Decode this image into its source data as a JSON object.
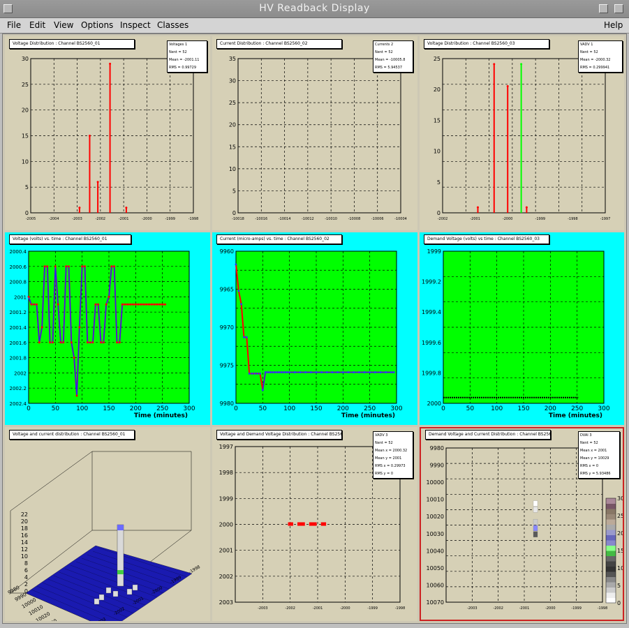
{
  "window": {
    "title": "HV Readback Display"
  },
  "menu": {
    "items": [
      "File",
      "Edit",
      "View",
      "Options",
      "Inspect",
      "Classes"
    ],
    "help": "Help"
  },
  "pads": [
    {
      "title": "Voltage Distribution : Channel BS2560_01",
      "stats": [
        "Voltages 1",
        "Nent = 52",
        "Mean = -2001.11",
        "RMS = 0.99729"
      ]
    },
    {
      "title": "Current Distribution : Channel BS2560_02",
      "stats": [
        "Currents 2",
        "Nent = 52",
        "Mean = -10005.8",
        "RMS = 5.94537"
      ]
    },
    {
      "title": "Voltage Distribution : Channel BS2560_03",
      "stats": [
        "VADV 1",
        "Nent = 52",
        "Mean = -2000.32",
        "RMS = 0.299941"
      ]
    },
    {
      "title": "Voltage (volts) vs. time : Channel BS2560_01"
    },
    {
      "title": "Current (micro-amps) vs. time : Channel BS2560_02"
    },
    {
      "title": "Demand Voltage (volts) vs time : Channel BS2560_03"
    },
    {
      "title": "Voltage and current distribution : Channel BS2560_01"
    },
    {
      "title": "Voltage and Demand Voltage Distribution : Channel BS2560_03",
      "stats": [
        "VADV 3",
        "Nent = 52",
        "Mean x = 2000.32",
        "Mean y = 2001",
        "RMS x = 0.29973",
        "RMS y = 0"
      ]
    },
    {
      "title": "Demand Voltage and Current Distribution : Channel BS2560_03",
      "stats": [
        "DVAI 3",
        "Nent = 52",
        "Mean x = 2001",
        "Mean y = 10029",
        "RMS x = 0",
        "RMS y = 5.93486"
      ]
    }
  ],
  "chart_data": [
    {
      "type": "bar",
      "xlim": [
        -2005,
        -1997
      ],
      "ylim": [
        0,
        30
      ],
      "xticks": [
        "-2005",
        "-2004",
        "-2003",
        "-2002",
        "-2001",
        "-2000",
        "-1999",
        "-1998"
      ],
      "yticks": [
        "0",
        "5",
        "10",
        "15",
        "20",
        "25",
        "30"
      ],
      "x": [
        -2002.6,
        -2002.1,
        -2001.7,
        -2001.1,
        -2000.3
      ],
      "values": [
        1,
        15,
        6,
        29,
        1
      ],
      "color": "#ff0000"
    },
    {
      "type": "bar",
      "xlim": [
        -10018,
        -10038
      ],
      "ylim": [
        0,
        38
      ],
      "xticks": [
        "-10018",
        "-10016",
        "-10014",
        "-10012",
        "-10010",
        "-10008",
        "-10006",
        "-10004"
      ],
      "yticks": [
        "0",
        "5",
        "10",
        "15",
        "20",
        "25",
        "30",
        "35"
      ],
      "x": [
        -10011.2,
        -10010.8,
        -10010.4,
        -10009.8,
        -10009.0,
        -10008.4
      ],
      "values": [
        7,
        35,
        3,
        2,
        2,
        1
      ],
      "color": "#000000"
    },
    {
      "type": "bar",
      "xlim": [
        -2003,
        -1997
      ],
      "ylim": [
        0,
        28
      ],
      "xticks": [
        "-2002",
        "-2001",
        "-2000",
        "-1999",
        "-1998",
        "-1997"
      ],
      "yticks": [
        "0",
        "5",
        "10",
        "15",
        "20",
        "25"
      ],
      "x": [
        -2001.7,
        -2001.1,
        -2000.6,
        -2000.1,
        -1999.9
      ],
      "values": [
        1,
        27,
        23,
        27,
        1
      ],
      "colors": [
        "#ff0000",
        "#ff0000",
        "#ff0000",
        "#00ff00",
        "#ff0000"
      ]
    },
    {
      "type": "line",
      "xlabel": "Time (minutes)",
      "xlim": [
        0,
        300
      ],
      "ylim": [
        2000.4,
        2002.4
      ],
      "xticks": [
        "0",
        "50",
        "100",
        "150",
        "200",
        "250",
        "300"
      ],
      "yticks": [
        "2000.4",
        "2000.6",
        "2000.8",
        "2001",
        "2001.2",
        "2001.4",
        "2001.6",
        "2001.8",
        "2002",
        "2002.2",
        "2002.4"
      ],
      "x": [
        0,
        5,
        10,
        15,
        20,
        25,
        30,
        35,
        40,
        45,
        50,
        55,
        60,
        65,
        70,
        75,
        80,
        85,
        90,
        95,
        100,
        105,
        110,
        115,
        120,
        125,
        130,
        135,
        140,
        145,
        150,
        155,
        160,
        165,
        170,
        175,
        180,
        185,
        190,
        195,
        200,
        205,
        210,
        215,
        220,
        225,
        230,
        235,
        240,
        245,
        250,
        255
      ],
      "values": [
        2001,
        2001.1,
        2001.1,
        2001.1,
        2001.6,
        2001.4,
        2000.6,
        2000.6,
        2001.6,
        2001.6,
        2000.6,
        2001.1,
        2001.6,
        2001.6,
        2000.6,
        2000.6,
        2001.6,
        2001.8,
        2002.3,
        2001.4,
        2000.6,
        2000.6,
        2001.6,
        2001.6,
        2001.6,
        2001.1,
        2001.1,
        2001.6,
        2001.6,
        2001.1,
        2001.0,
        2000.6,
        2000.6,
        2001.6,
        2001.6,
        2001.1,
        2001.1,
        2001.1,
        2001.1,
        2001.1,
        2001.1,
        2001.1,
        2001.1,
        2001.1,
        2001.1,
        2001.1,
        2001.1,
        2001.1,
        2001.1,
        2001.1,
        2001.1,
        2001.1
      ]
    },
    {
      "type": "line",
      "xlabel": "Time (minutes)",
      "xlim": [
        0,
        300
      ],
      "ylim": [
        9960,
        9980
      ],
      "xticks": [
        "0",
        "50",
        "100",
        "150",
        "200",
        "250",
        "300"
      ],
      "yticks": [
        "9960",
        "9965",
        "9970",
        "9975",
        "9980"
      ],
      "x": [
        0,
        5,
        10,
        15,
        20,
        25,
        30,
        35,
        40,
        45,
        50,
        55,
        60,
        65,
        70,
        75,
        80,
        85,
        90,
        95,
        100,
        110,
        120,
        130,
        140,
        150,
        160,
        170,
        180,
        190,
        200,
        210,
        220,
        230,
        240,
        250,
        260,
        270,
        280,
        290,
        295
      ],
      "values": [
        9960,
        9964,
        9966,
        9971,
        9971,
        9976.5,
        9976.5,
        9976.5,
        9976.5,
        9976.5,
        9979,
        9976.3,
        9976.3,
        9976.3,
        9976.3,
        9976.3,
        9976.3,
        9976.3,
        9976.3,
        9976.3,
        9976.3,
        9976.3,
        9976.3,
        9976.3,
        9976.3,
        9976.3,
        9976.3,
        9976.3,
        9976.3,
        9976.3,
        9976.3,
        9976.3,
        9976.3,
        9976.3,
        9976.3,
        9976.3,
        9976.3,
        9976.3,
        9976.3,
        9976.3,
        9976.3
      ]
    },
    {
      "type": "line",
      "xlabel": "Time (minutes)",
      "xlim": [
        0,
        300
      ],
      "ylim": [
        1999,
        2000
      ],
      "xticks": [
        "0",
        "50",
        "100",
        "150",
        "200",
        "250",
        "300"
      ],
      "yticks": [
        "1999",
        "1999.2",
        "1999.4",
        "1999.6",
        "1999.8",
        "2000"
      ],
      "x": [
        0,
        300
      ],
      "values": [
        2000,
        2000
      ]
    },
    {
      "type": "heatmap",
      "zticks": [
        "0",
        "2",
        "4",
        "6",
        "8",
        "10",
        "12",
        "14",
        "16",
        "18",
        "20",
        "22"
      ],
      "yticks": [
        "9980",
        "9990",
        "10000",
        "10010",
        "10020",
        "10030",
        "10040",
        "10050",
        "10060",
        "10070"
      ],
      "xticks": [
        "-2003",
        "-2002",
        "-2001",
        "-2000",
        "-1999",
        "-1998"
      ]
    },
    {
      "type": "scatter",
      "xlim": [
        -2004,
        -1997
      ],
      "ylim": [
        1997,
        2003
      ],
      "xticks": [
        "-2003",
        "-2002",
        "-2001",
        "-2000",
        "-1999",
        "-1998"
      ],
      "yticks": [
        "1997",
        "1998",
        "1999",
        "2000",
        "2001",
        "2002",
        "2003"
      ],
      "x": [
        -2001.7,
        -2001.6,
        -2001.3,
        -2001.2,
        -2001.1,
        -2000.8,
        -2000.7,
        -2000.6,
        -2000.3,
        -2000.2
      ],
      "values": [
        2000,
        2000,
        2000,
        2000,
        2000,
        2000,
        2000,
        2000,
        2000,
        2000
      ]
    },
    {
      "type": "heatmap",
      "xlim": [
        -2004,
        -1997
      ],
      "ylim": [
        9980,
        10080
      ],
      "xticks": [
        "-2003",
        "-2002",
        "-2001",
        "-2000",
        "-1999",
        "-1998"
      ],
      "yticks": [
        "9980",
        "9990",
        "10000",
        "10010",
        "10020",
        "10030",
        "10040",
        "10050",
        "10060",
        "10070"
      ],
      "zticks": [
        "0",
        "5",
        "10",
        "15",
        "20",
        "25",
        "30"
      ],
      "cells": [
        {
          "x": -2000,
          "y": 10016,
          "z": 3
        },
        {
          "x": -2000,
          "y": 10020,
          "z": 5
        },
        {
          "x": -2000,
          "y": 10028,
          "z": 8
        },
        {
          "x": -2000,
          "y": 10032,
          "z": 24
        },
        {
          "x": -2000,
          "y": 10036,
          "z": 18
        }
      ]
    }
  ]
}
